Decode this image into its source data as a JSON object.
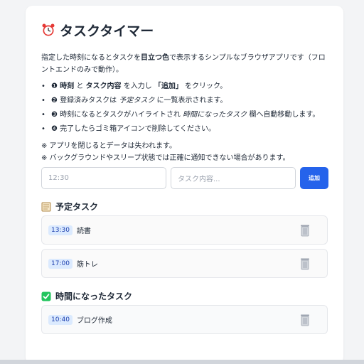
{
  "app": {
    "title": "タスクタイマー",
    "icon": "alarm-clock-icon"
  },
  "description": {
    "part1": "指定した時刻になるとタスクを",
    "bold": "目立つ色",
    "part2": "で表示するシンプルなブラウザアプリです（フロントエンドのみで動作）。"
  },
  "steps": [
    {
      "marker": "❶",
      "b1": "時刻",
      "t1": " と ",
      "b2": "タスク内容",
      "t2": " を入力し ",
      "b3": "「追加」",
      "t3": " をクリック。"
    },
    {
      "marker": "❷",
      "t1": "登録済みタスクは ",
      "i1": "予定タスク",
      "t2": " に一覧表示されます。"
    },
    {
      "marker": "❸",
      "t1": "時刻になるとタスクがハイライトされ ",
      "i1": "時間になったタスク",
      "t2": " 欄へ自動移動します。"
    },
    {
      "marker": "❹",
      "t1": "完了したらゴミ箱アイコンで削除してください。"
    }
  ],
  "notes": [
    "※ アプリを閉じるとデータは失われます。",
    "※ バックグラウンドやスリープ状態では正確に通知できない場合があります。"
  ],
  "form": {
    "time_value": "12:30",
    "task_placeholder": "タスク内容...",
    "add_label": "追加"
  },
  "scheduled": {
    "title": "予定タスク",
    "icon": "memo-icon",
    "items": [
      {
        "time": "13:30",
        "text": "読書"
      },
      {
        "time": "17:00",
        "text": "筋トレ"
      }
    ]
  },
  "due": {
    "title": "時間になったタスク",
    "icon": "check-mark-icon",
    "items": [
      {
        "time": "10:40",
        "text": "ブログ作成"
      }
    ]
  },
  "colors": {
    "accent": "#2563eb",
    "badge_bg": "#dbeafe",
    "badge_text": "#1e40af",
    "check_green": "#22c55e"
  }
}
